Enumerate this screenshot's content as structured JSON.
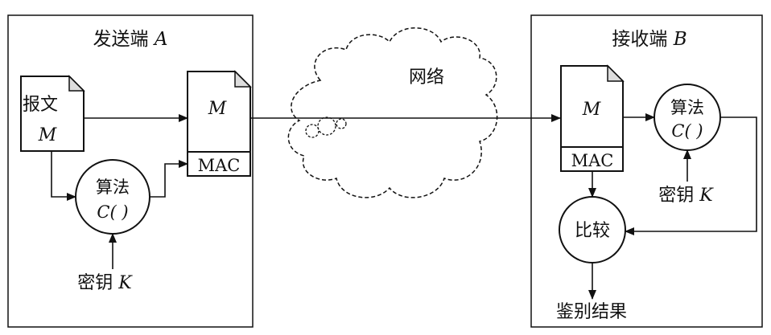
{
  "sender": {
    "title_prefix": "发送端 ",
    "title_var": "A",
    "message_label": "报文",
    "message_var": "M",
    "doc_var": "M",
    "mac_label": "MAC",
    "algo_label": "算法",
    "algo_func": "C( )",
    "key_prefix": "密钥 ",
    "key_var": "K"
  },
  "network": {
    "label": "网络"
  },
  "receiver": {
    "title_prefix": "接收端 ",
    "title_var": "B",
    "doc_var": "M",
    "mac_label": "MAC",
    "algo_label": "算法",
    "algo_func": "C( )",
    "key_prefix": "密钥 ",
    "key_var": "K",
    "compare_label": "比较",
    "result_label": "鉴别结果"
  },
  "colors": {
    "stroke": "#111111",
    "background": "#ffffff"
  }
}
